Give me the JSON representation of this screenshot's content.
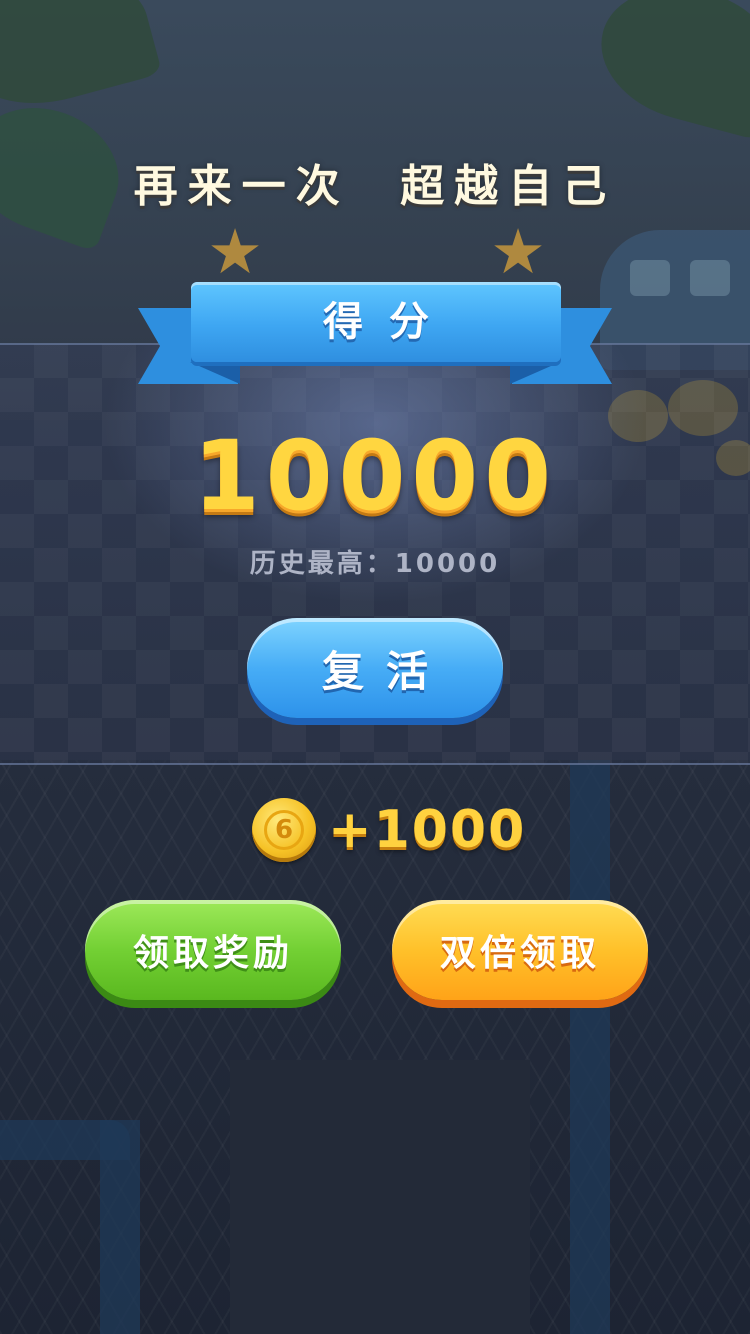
{
  "headline": "再来一次  超越自己",
  "score_banner": {
    "label": "得分"
  },
  "score": "10000",
  "best_score": "历史最高：10000",
  "revive_button": {
    "label": "复活"
  },
  "reward": {
    "amount": "+1000",
    "icon": "coin-icon"
  },
  "claim_button": {
    "label": "领取奖励",
    "color": "#73d034"
  },
  "double_claim_button": {
    "label": "双倍领取",
    "color": "#ffc12a"
  },
  "colors": {
    "score": "#ffd640",
    "ribbon": "#3ea6f2",
    "revive": "#47adf6"
  }
}
